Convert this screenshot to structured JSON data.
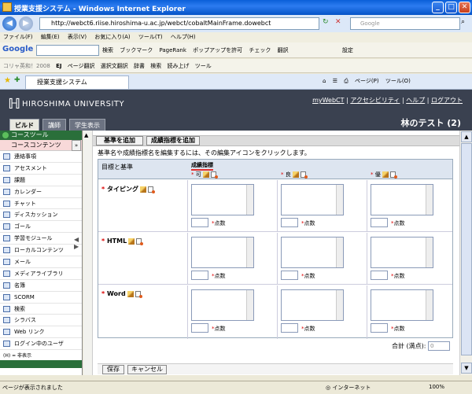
{
  "window": {
    "title": "授業支援システム - Windows Internet Explorer",
    "minimize": "_",
    "maximize": "□",
    "close": "✕"
  },
  "address": {
    "url": "http://webct6.riise.hiroshima-u.ac.jp/webct/cobaltMainFrame.dowebct",
    "search_placeholder": "Google"
  },
  "menu": [
    "ファイル(F)",
    "編集(E)",
    "表示(V)",
    "お気に入り(A)",
    "ツール(T)",
    "ヘルプ(H)"
  ],
  "google_toolbar": {
    "label": "Google",
    "items": [
      "検索",
      "ブックマーク",
      "PageRank",
      "ポップアップを許可",
      "チェック",
      "翻訳",
      "設定"
    ]
  },
  "toolbar2": {
    "items": [
      "コリャ英和！2008",
      "EJ",
      "ページ翻訳",
      "選択文翻訳",
      "辞書",
      "検索",
      "読み上げ",
      "ツール"
    ]
  },
  "ie_tab": {
    "label": "授業支援システム",
    "tools": [
      "ページ(P)",
      "ツール(O)"
    ]
  },
  "header": {
    "university": "HIROSHIMA UNIVERSITY",
    "links": [
      "myWebCT",
      "アクセシビリティ",
      "ヘルプ",
      "ログアウト"
    ],
    "course_title": "林のテスト (2)",
    "tabs": [
      "ビルド",
      "講師",
      "学生表示"
    ]
  },
  "sidebar": {
    "head": "コースツール",
    "content_label": "コースコンテンツ",
    "items": [
      "連絡事項",
      "アセスメント",
      "課題",
      "カレンダー",
      "チャット",
      "ディスカッション",
      "ゴール",
      "学習モジュール",
      "ローカルコンテンツ",
      "メール",
      "メディアライブラリ",
      "名簿",
      "SCORM",
      "検索",
      "シラバス",
      "Web リンク",
      "ログイン中のユーザ"
    ],
    "footnote": "(H) = 非表示"
  },
  "actions": {
    "add_criterion": "基準を追加",
    "add_level": "成績指標を追加"
  },
  "instruction": "基準名や成績指標名を編集するには、その編集アイコンをクリックします。",
  "rubric": {
    "criteria_header": "目標と基準",
    "levels_header": "成績指標",
    "levels": [
      "可",
      "良",
      "優"
    ],
    "criteria": [
      "タイピング",
      "HTML",
      "Word"
    ],
    "points_label": "点数",
    "total_label": "合計 (満点):",
    "total_value": "0"
  },
  "bottom": {
    "save": "保存",
    "cancel": "キャンセル"
  },
  "status": {
    "text": "ページが表示されました",
    "zone": "インターネット",
    "zoom": "100%"
  }
}
